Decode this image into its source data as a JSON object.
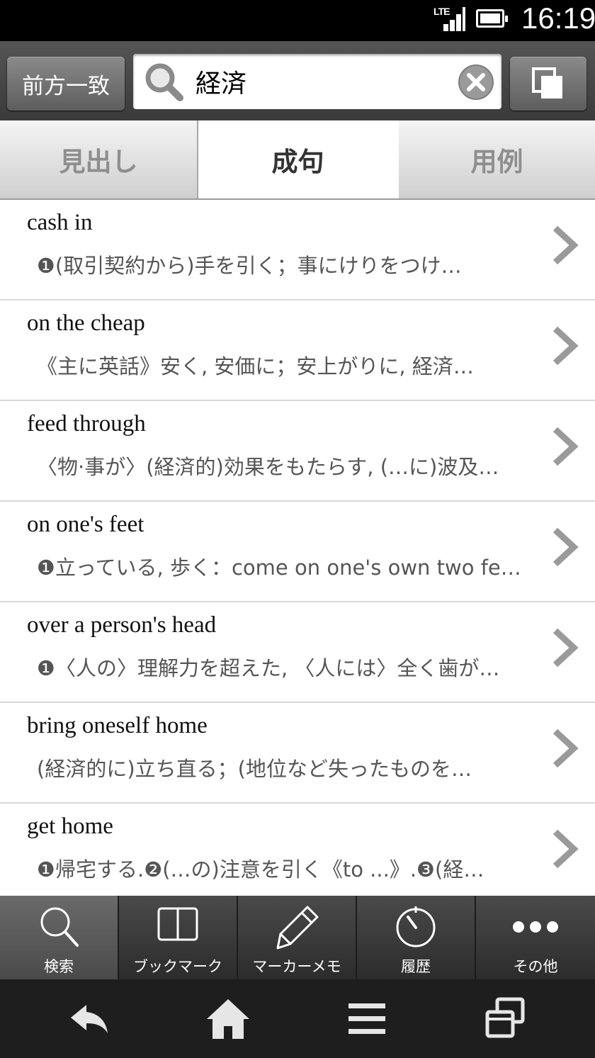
{
  "status_bar": {
    "network": "LTE",
    "time": "16:19"
  },
  "search": {
    "mode_label": "前方一致",
    "query": "経済"
  },
  "tabs": [
    {
      "label": "見出し",
      "active": false
    },
    {
      "label": "成句",
      "active": true
    },
    {
      "label": "用例",
      "active": false
    }
  ],
  "results": [
    {
      "term": "cash in",
      "definition": "❶(取引契約から)手を引く；事にけりをつけ…"
    },
    {
      "term": "on the cheap",
      "definition": "《主に英話》安く, 安価に；安上がりに, 経済…"
    },
    {
      "term": "feed through",
      "definition": "〈物·事が〉(経済的)効果をもたらす, (…に)波及…"
    },
    {
      "term": "on one's feet",
      "definition": "❶立っている, 歩く：come on one's own two fe…"
    },
    {
      "term": "over a person's head",
      "definition": "❶〈人の〉理解力を超えた, 〈人には〉全く歯が…"
    },
    {
      "term": "bring oneself home",
      "definition": "(経済的に)立ち直る；(地位など失ったものを…"
    },
    {
      "term": "get home",
      "definition": "❶帰宅する.❷(…の)注意を引く《to ...》.❸(経…"
    }
  ],
  "bottom_nav": [
    {
      "label": "検索",
      "icon": "search-icon",
      "active": true
    },
    {
      "label": "ブックマーク",
      "icon": "book-icon",
      "active": false
    },
    {
      "label": "マーカーメモ",
      "icon": "pen-icon",
      "active": false
    },
    {
      "label": "履歴",
      "icon": "history-icon",
      "active": false
    },
    {
      "label": "その他",
      "icon": "more-icon",
      "active": false
    }
  ],
  "colors": {
    "header_bg": "#464646",
    "tab_inactive_text": "#8e8e8e",
    "chevron": "#9a9a9a"
  }
}
